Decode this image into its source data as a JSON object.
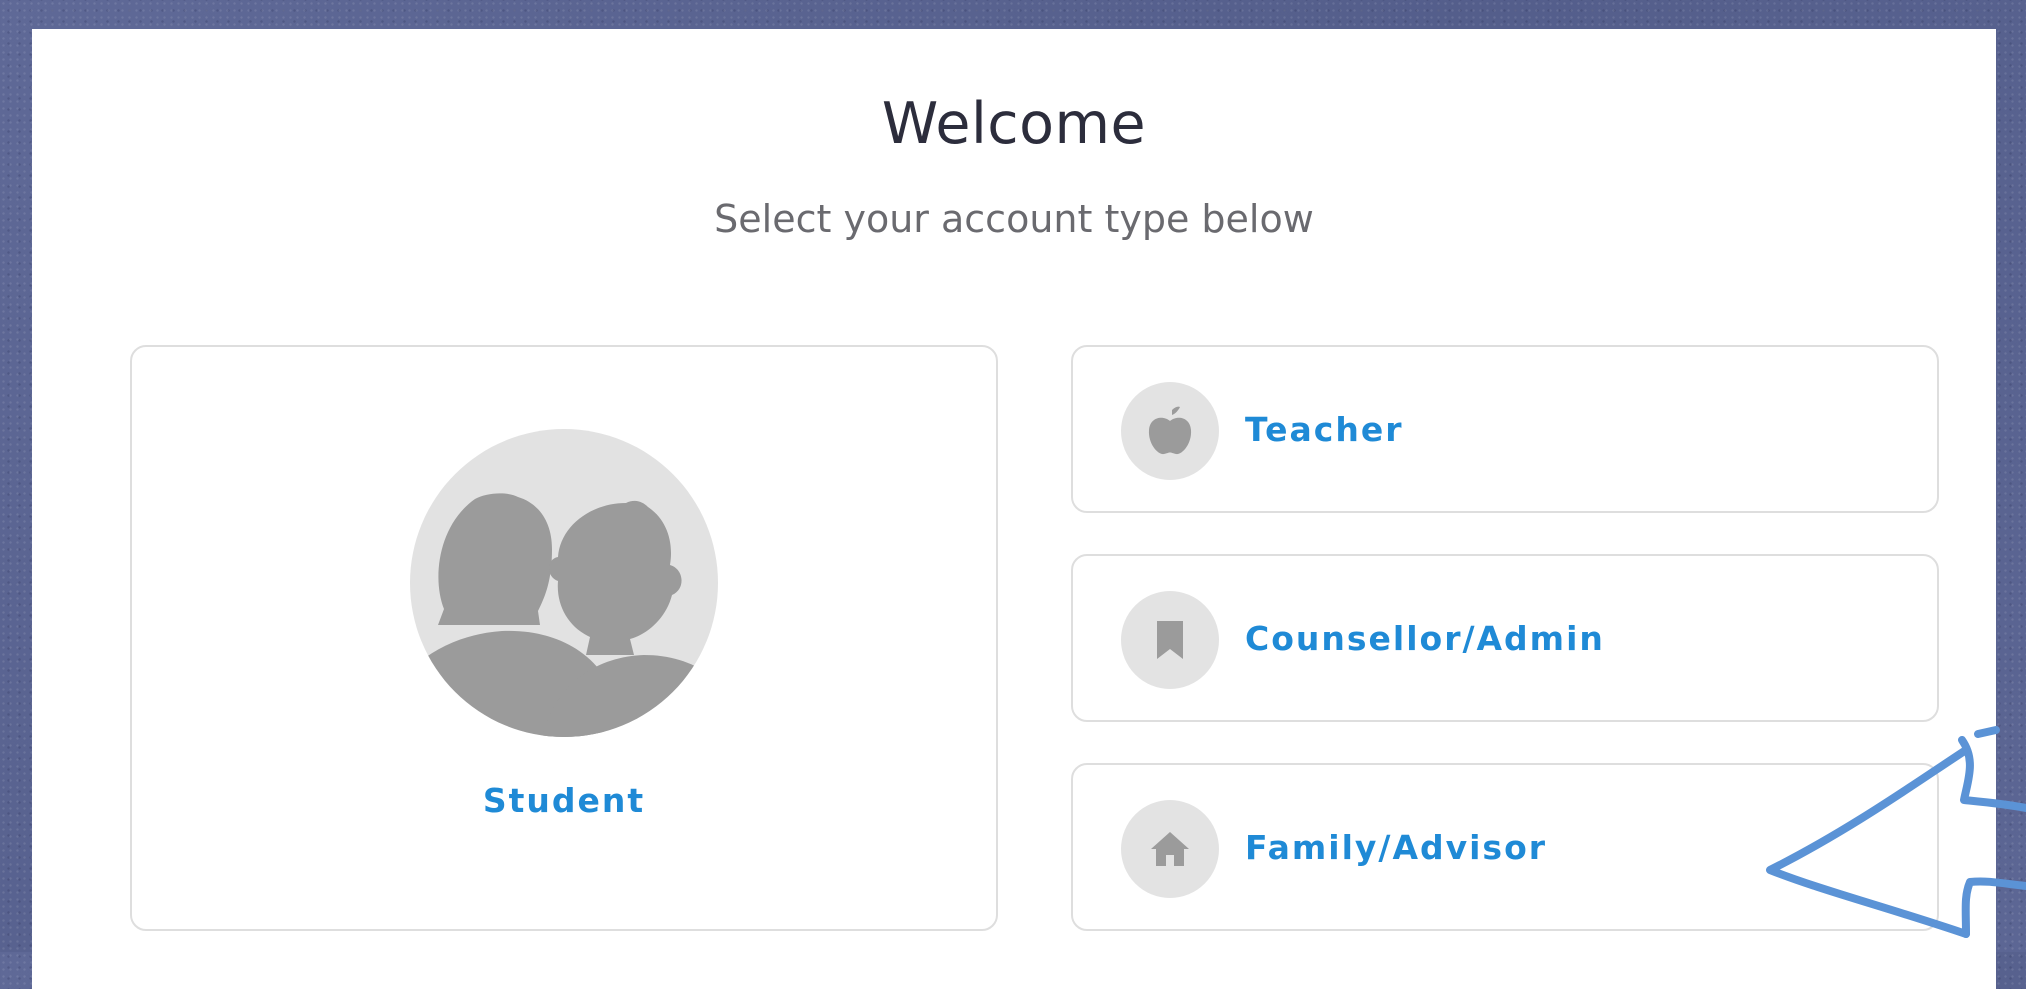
{
  "header": {
    "title": "Welcome",
    "subtitle": "Select your account type below"
  },
  "account_types": {
    "student": {
      "label": "Student",
      "icon": "people-silhouette-icon"
    },
    "teacher": {
      "label": "Teacher",
      "icon": "apple-icon"
    },
    "counsellor": {
      "label": "Counsellor/Admin",
      "icon": "bookmark-icon"
    },
    "family": {
      "label": "Family/Advisor",
      "icon": "home-icon"
    }
  },
  "colors": {
    "accent": "#1f8ad6",
    "icon_gray": "#9b9b9b",
    "icon_bg": "#e3e3e3",
    "annotation": "#5b93d6",
    "background": "#5a6491"
  }
}
